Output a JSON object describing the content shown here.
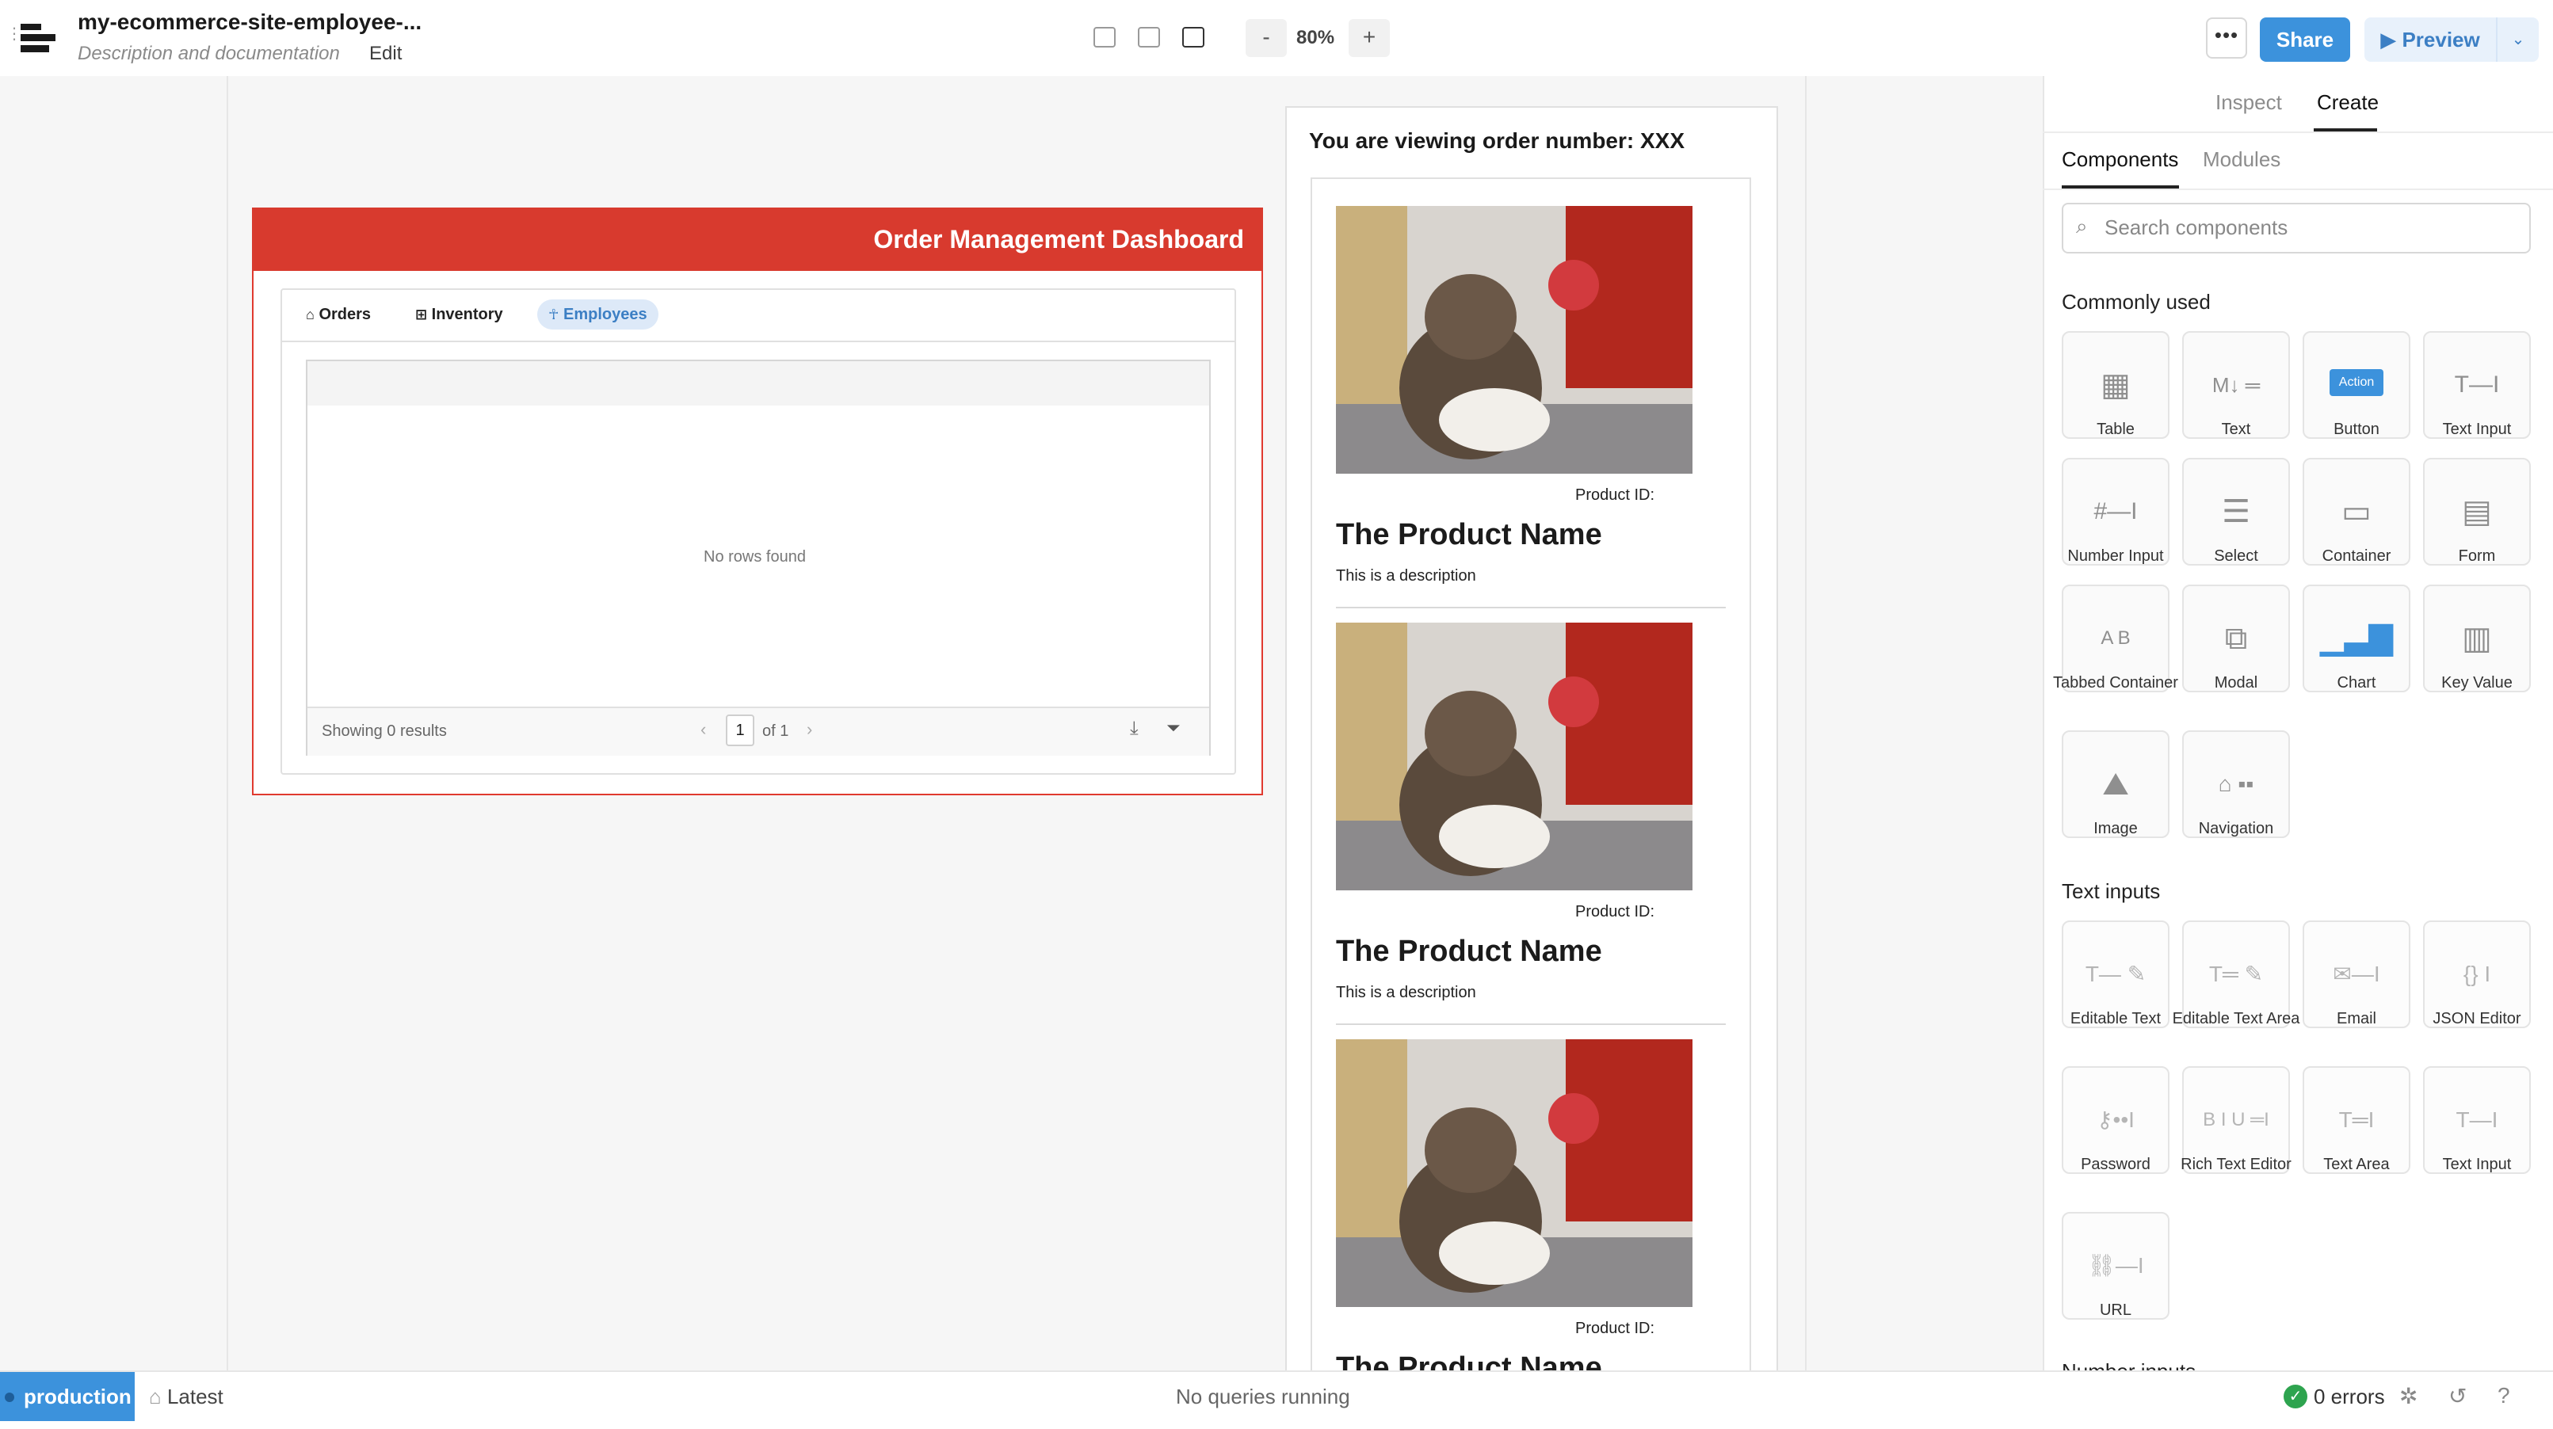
{
  "header": {
    "app_title": "my-ecommerce-site-employee-...",
    "description": "Description and documentation",
    "edit_label": "Edit",
    "zoom_minus": "-",
    "zoom_value": "80%",
    "zoom_plus": "+",
    "more_label": "•••",
    "share_label": "Share",
    "preview_label": "▶ Preview",
    "preview_dropdown": "⌄"
  },
  "dashboard": {
    "title": "Order Management Dashboard",
    "tabs": [
      {
        "label": "Orders",
        "icon": "⌂"
      },
      {
        "label": "Inventory",
        "icon": "⊞"
      },
      {
        "label": "Employees",
        "icon": "☥"
      }
    ],
    "table": {
      "empty_text": "No rows found",
      "footer_text": "Showing 0 results",
      "page_current": "1",
      "page_of": "of 1"
    }
  },
  "order_panel": {
    "title": "You are viewing order number: XXX",
    "products": [
      {
        "id_label": "Product ID:",
        "name": "The Product Name",
        "description": "This is a description"
      },
      {
        "id_label": "Product ID:",
        "name": "The Product Name",
        "description": "This is a description"
      },
      {
        "id_label": "Product ID:",
        "name": "The Product Name",
        "description": ""
      }
    ]
  },
  "sidebar": {
    "tabs": [
      "Inspect",
      "Create"
    ],
    "active_tab": "Create",
    "subtabs": [
      "Components",
      "Modules"
    ],
    "active_subtab": "Components",
    "search_placeholder": "Search components",
    "sections": [
      {
        "heading": "Commonly used",
        "items": [
          "Table",
          "Text",
          "Button",
          "Text Input",
          "Number Input",
          "Select",
          "Container",
          "Form",
          "Tabbed Container",
          "Modal",
          "Chart",
          "Key Value",
          "Image",
          "Navigation"
        ]
      },
      {
        "heading": "Text inputs",
        "items": [
          "Editable Text",
          "Editable Text Area",
          "Email",
          "JSON Editor",
          "Password",
          "Rich Text Editor",
          "Text Area",
          "Text Input",
          "URL"
        ]
      },
      {
        "heading": "Number inputs",
        "items": []
      }
    ],
    "button_tile_text": "Action"
  },
  "statusbar": {
    "environment": "production",
    "version": "Latest",
    "queries": "No queries running",
    "errors": "0 errors"
  },
  "colors": {
    "accent": "#3c92dc",
    "dashboard_header": "#d83a2e",
    "success": "#2ea44f"
  }
}
